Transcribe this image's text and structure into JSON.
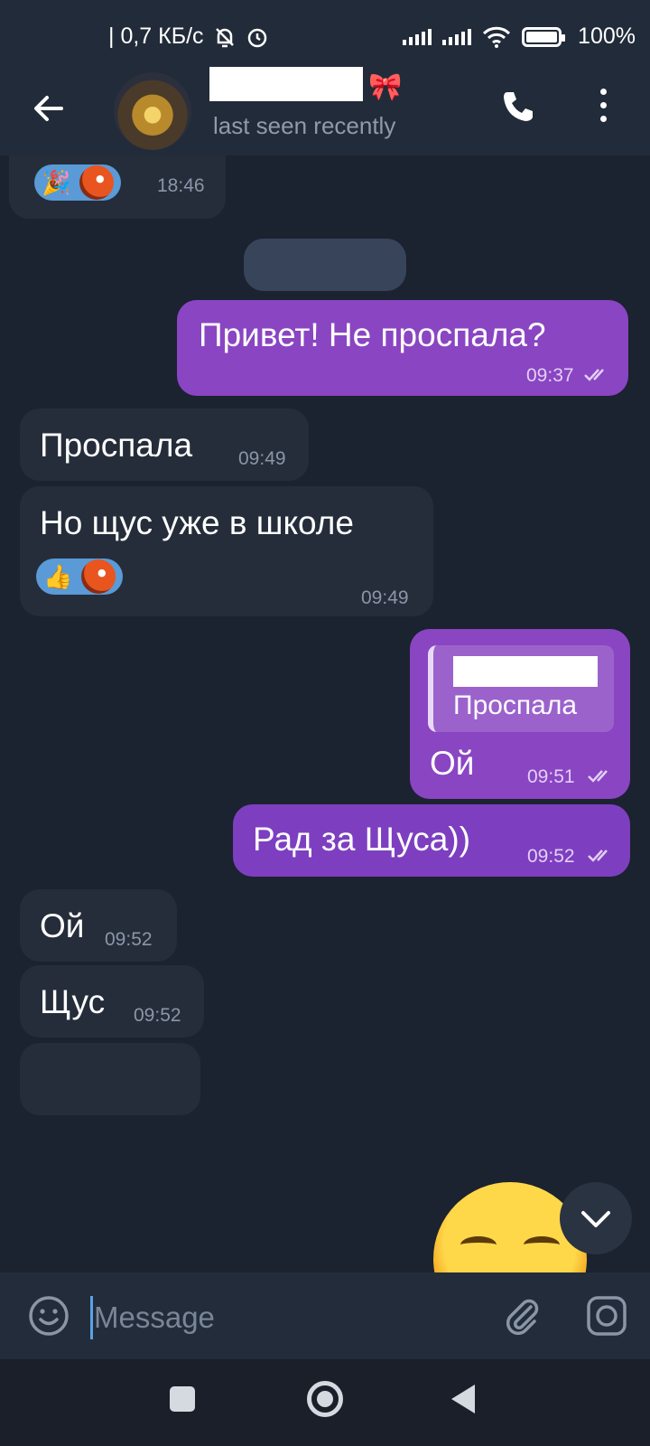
{
  "status_bar": {
    "speed": "| 0,7 КБ/с",
    "battery": "100%",
    "icons": [
      "mute-bell-icon",
      "alarm-icon",
      "signal-icon",
      "signal-icon",
      "wifi-icon",
      "battery-icon"
    ]
  },
  "header": {
    "status": "last seen recently",
    "icons": [
      "back-arrow-icon",
      "phone-icon",
      "more-vert-icon"
    ]
  },
  "messages": [
    {
      "dir": "in",
      "text": "",
      "time": "18:46",
      "reactions": [
        "🎉"
      ]
    },
    {
      "dir": "out",
      "text": "Привет! Не проспала?",
      "time": "09:37"
    },
    {
      "dir": "in",
      "text": "Проспала",
      "time": "09:49"
    },
    {
      "dir": "in",
      "text": "Но щус уже в школе",
      "time": "09:49",
      "reactions": [
        "👍"
      ]
    },
    {
      "dir": "out",
      "text": "Ой",
      "time": "09:51",
      "reply": {
        "text": "Проспала"
      }
    },
    {
      "dir": "out",
      "text": "Рад за Щуса))",
      "time": "09:52"
    },
    {
      "dir": "in",
      "text": "Ой",
      "time": "09:52"
    },
    {
      "dir": "in",
      "text": "Щус",
      "time": "09:52"
    }
  ],
  "input": {
    "placeholder": "Message",
    "icons": [
      "emoji-icon",
      "attach-icon",
      "camera-icon"
    ]
  },
  "colors": {
    "background": "#1b2230",
    "incoming_bubble": "#252d3a",
    "outgoing_bubble": "#8a45c2",
    "reaction_pill": "#5a9ad7"
  }
}
